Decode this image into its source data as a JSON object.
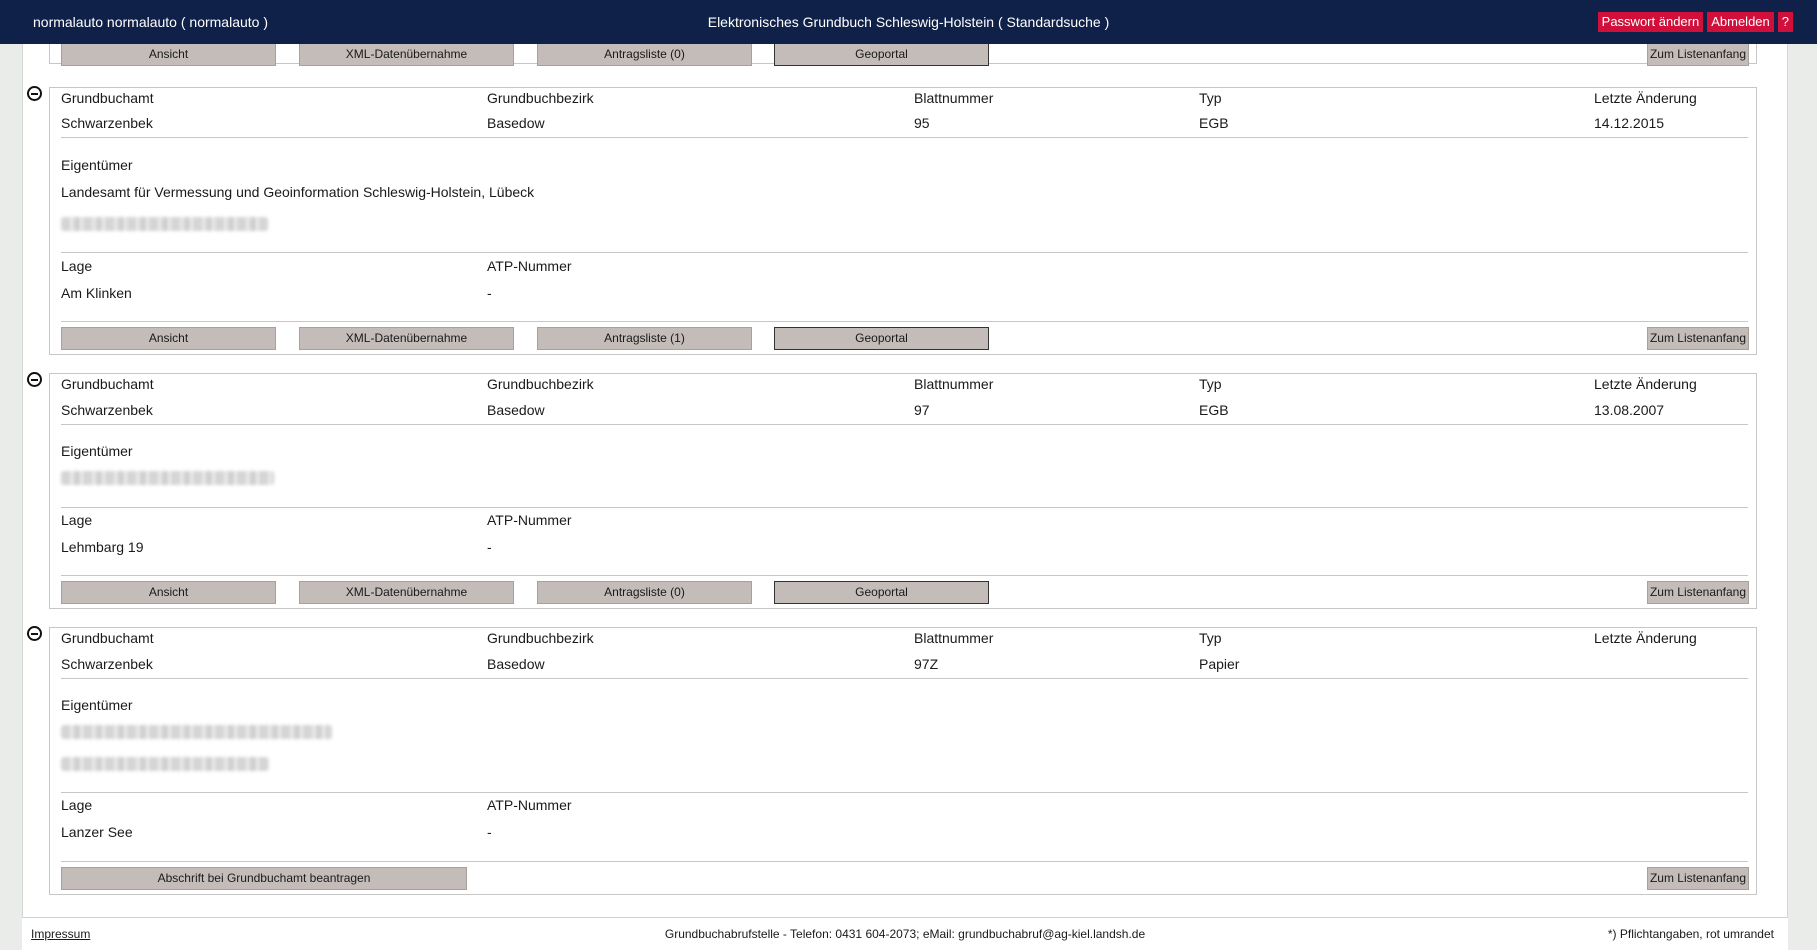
{
  "header": {
    "user": "normalauto normalauto  ( normalauto )",
    "title": "Elektronisches Grundbuch Schleswig-Holstein  ( Standardsuche )",
    "change_password": "Passwort ändern",
    "logout": "Abmelden",
    "help": "?"
  },
  "labels": {
    "grundbuchamt": "Grundbuchamt",
    "grundbuchbezirk": "Grundbuchbezirk",
    "blattnummer": "Blattnummer",
    "typ": "Typ",
    "letzte_aenderung": "Letzte Änderung",
    "eigentuemer": "Eigentümer",
    "lage": "Lage",
    "atp_nummer": "ATP-Nummer"
  },
  "buttons": {
    "ansicht": "Ansicht",
    "xml": "XML-Datenübernahme",
    "geoportal": "Geoportal",
    "zum_listenanfang": "Zum Listenanfang",
    "abschrift": "Abschrift bei Grundbuchamt beantragen"
  },
  "top_bar": {
    "antragsliste": "Antragsliste (0)"
  },
  "records": [
    {
      "grundbuchamt": "Schwarzenbek",
      "grundbuchbezirk": "Basedow",
      "blattnummer": "95",
      "typ": "EGB",
      "letzte_aenderung": "14.12.2015",
      "eigentuemer_line": "Landesamt für Vermessung und Geoinformation Schleswig-Holstein, Lübeck",
      "lage": "Am Klinken",
      "atp_nummer": "-",
      "antragsliste": "Antragsliste (1)"
    },
    {
      "grundbuchamt": "Schwarzenbek",
      "grundbuchbezirk": "Basedow",
      "blattnummer": "97",
      "typ": "EGB",
      "letzte_aenderung": "13.08.2007",
      "lage": "Lehmbarg 19",
      "atp_nummer": "-",
      "antragsliste": "Antragsliste (0)"
    },
    {
      "grundbuchamt": "Schwarzenbek",
      "grundbuchbezirk": "Basedow",
      "blattnummer": "97Z",
      "typ": "Papier",
      "letzte_aenderung": "",
      "lage": "Lanzer See",
      "atp_nummer": "-"
    }
  ],
  "footer": {
    "impressum": "Impressum",
    "contact": "Grundbuchabrufstelle - Telefon: 0431 604-2073; eMail: grundbuchabruf@ag-kiel.landsh.de",
    "note": "*) Pflichtangaben, rot umrandet"
  }
}
